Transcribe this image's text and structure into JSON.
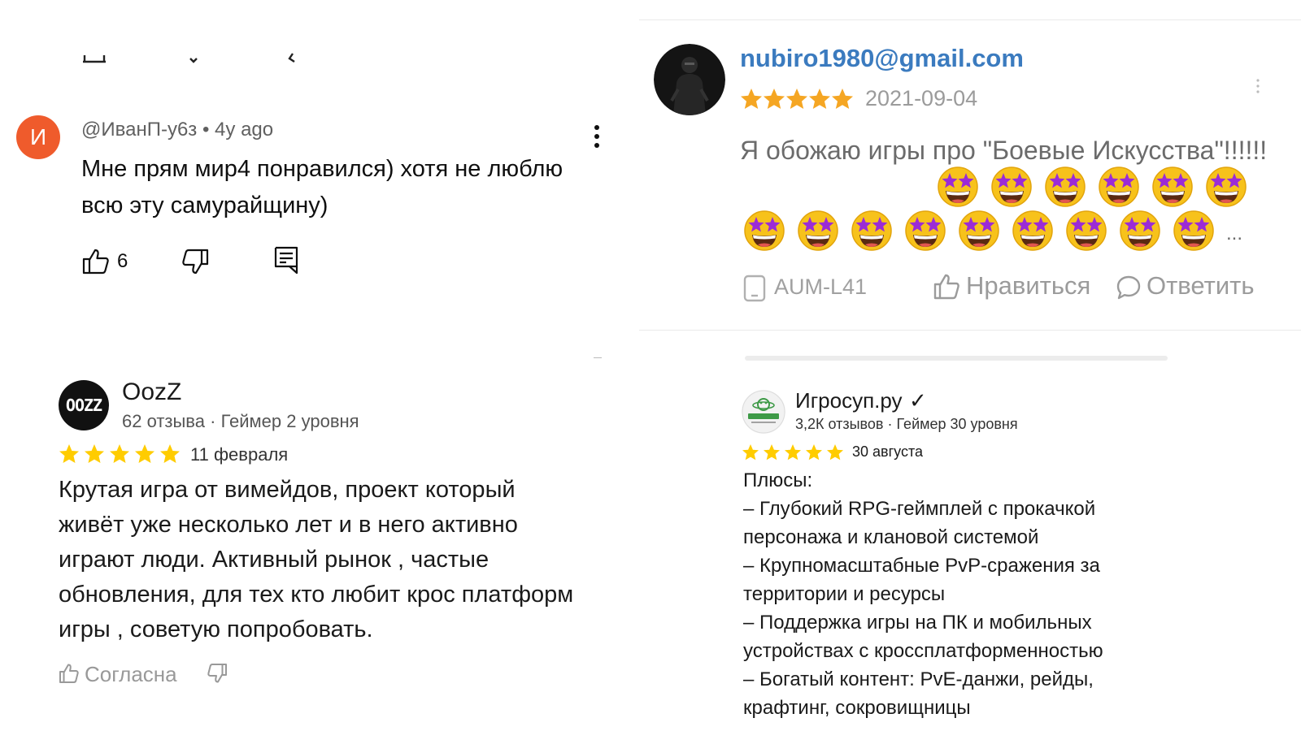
{
  "youtube_comment": {
    "avatar_letter": "И",
    "author": "@ИванП-у6з",
    "time": "4y ago",
    "text": "Мне прям мир4 понравился) хотя не люблю всю эту самурайщину)",
    "like_count": "6",
    "colors": {
      "avatar_bg": "#ef5b2c"
    }
  },
  "email_review": {
    "author": "nubiro1980@gmail.com",
    "rating": 5,
    "date": "2021-09-04",
    "text": "Я обожаю игры про \"Боевые Искусства\"!!!!!!",
    "emoji_count": 15,
    "emoji_name": "star-struck",
    "ellipsis": "...",
    "device": "AUM-L41",
    "like_label": "Нравиться",
    "reply_label": "Ответить",
    "colors": {
      "author": "#3b7bbf",
      "star": "#f5a623"
    }
  },
  "yandex_review_oozz": {
    "avatar_text": "OOZZ",
    "author": "OozZ",
    "reviews_count": "62 отзыва",
    "gamer_level": "Геймер 2 уровня",
    "rating": 5,
    "date": "11 февраля",
    "text": "Крутая игра от вимейдов, проект который живёт уже несколько лет и в него активно играют люди. Активный рынок , частые обновления, для тех кто любит крос платформ игры , советую попробовать.",
    "agree_label": "Согласна",
    "colors": {
      "star": "#ffcc00"
    }
  },
  "yandex_review_igrosup": {
    "author": "Игросуп.ру",
    "verified_mark": "✓",
    "reviews_count": "3,2К отзывов",
    "gamer_level": "Геймер 30 уровня",
    "rating": 5,
    "date": "30 августа",
    "lines": [
      "Плюсы:",
      "– Глубокий RPG-геймплей с прокачкой",
      "персонажа и клановой системой",
      "– Крупномасштабные PvP-сражения за",
      "территории и ресурсы",
      "– Поддержка игры на ПК и мобильных",
      "устройствах с кроссплатформенностью",
      "– Богатый контент: PvE-данжи, рейды,",
      "крафтинг, сокровищницы"
    ],
    "colors": {
      "star": "#ffcc00"
    }
  }
}
